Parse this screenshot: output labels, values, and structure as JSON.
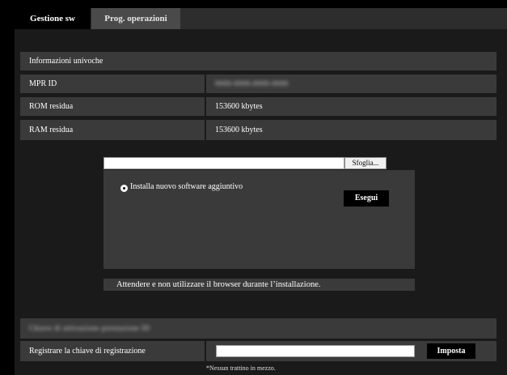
{
  "tabs": [
    {
      "label": "Gestione sw",
      "active": true
    },
    {
      "label": "Prog. operazioni",
      "active": false
    }
  ],
  "info_section": {
    "header": "Informazioni univoche",
    "rows": [
      {
        "label": "MPR ID",
        "value": "0000-0000-0000-0000"
      },
      {
        "label": "ROM residua",
        "value": "153600 kbytes"
      },
      {
        "label": "RAM residua",
        "value": "153600 kbytes"
      }
    ]
  },
  "upload": {
    "file_value": "",
    "browse_label": "Sfoglia...",
    "radio_label": "Installa nuovo software aggiuntivo",
    "radio_selected": true,
    "execute_label": "Esegui",
    "warning": "Attendere e non utilizzare il browser durante l’installazione."
  },
  "key_section": {
    "header": "Chiave di attivazione prestazione ID",
    "label": "Registrare la chiave di registrazione",
    "input_value": "",
    "set_label": "Imposta",
    "note": "*Nessun trattino in mezzo."
  },
  "colors": {
    "background": "#000000",
    "panel": "#1a1a1a",
    "row": "#3a3a3a",
    "tab_inactive": "#4a4a4a"
  }
}
